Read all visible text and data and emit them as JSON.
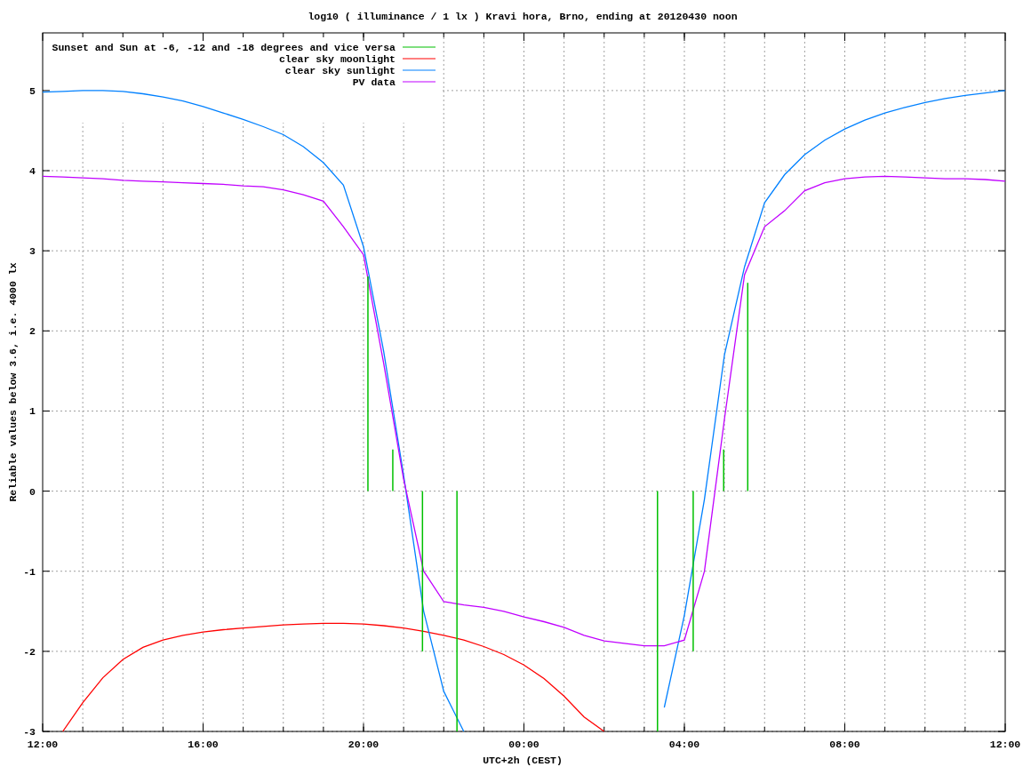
{
  "chart_data": {
    "type": "line",
    "title": "log10 ( illuminance / 1 lx ) Kravi hora, Brno, ending at 20120430 noon",
    "xlabel": "UTC+2h (CEST)",
    "ylabel": "Reliable values below 3.6, i.e. 4000 lx",
    "ylim": [
      -3,
      5.72
    ],
    "grid": true,
    "legend": true,
    "yticks": [
      -3,
      -2,
      -1,
      0,
      1,
      2,
      3,
      4,
      5
    ],
    "categories": [
      "12:00",
      null,
      null,
      null,
      null,
      null,
      null,
      null,
      "16:00",
      null,
      null,
      null,
      null,
      null,
      null,
      null,
      "20:00",
      null,
      null,
      null,
      null,
      null,
      null,
      null,
      "00:00",
      null,
      null,
      null,
      null,
      null,
      null,
      null,
      "04:00",
      null,
      null,
      null,
      null,
      null,
      null,
      null,
      "08:00",
      null,
      null,
      null,
      null,
      null,
      null,
      null,
      "12:00"
    ],
    "series": [
      {
        "name": "clear sky moonlight",
        "color": "#ff0000",
        "values": [
          null,
          -3.0,
          -2.64,
          -2.33,
          -2.1,
          -1.95,
          -1.86,
          -1.8,
          -1.76,
          -1.73,
          -1.71,
          -1.69,
          -1.67,
          -1.66,
          -1.65,
          -1.65,
          -1.66,
          -1.68,
          -1.71,
          -1.75,
          -1.8,
          -1.86,
          -1.94,
          -2.04,
          -2.17,
          -2.34,
          -2.56,
          -2.82,
          -3.0,
          null,
          null,
          null,
          null,
          null,
          null,
          null,
          null,
          null,
          null,
          null,
          null,
          null,
          null,
          null,
          null,
          null,
          null,
          null,
          null
        ]
      },
      {
        "name": "clear sky sunlight",
        "color": "#0080ff",
        "values": [
          4.98,
          4.99,
          5.0,
          5.0,
          4.99,
          4.96,
          4.92,
          4.87,
          4.8,
          4.72,
          4.64,
          4.55,
          4.45,
          4.3,
          4.1,
          3.82,
          3.05,
          1.75,
          0.2,
          -1.5,
          -2.5,
          -3.0,
          null,
          null,
          null,
          null,
          null,
          null,
          null,
          null,
          null,
          -2.7,
          -1.55,
          -0.1,
          1.7,
          2.8,
          3.6,
          3.95,
          4.2,
          4.38,
          4.52,
          4.63,
          4.72,
          4.79,
          4.85,
          4.9,
          4.94,
          4.97,
          5.0
        ]
      },
      {
        "name": "PV data",
        "color": "#c000ff",
        "values": [
          3.93,
          3.92,
          3.91,
          3.9,
          3.88,
          3.87,
          3.86,
          3.85,
          3.84,
          3.83,
          3.81,
          3.8,
          3.76,
          3.7,
          3.62,
          3.3,
          2.95,
          1.6,
          0.15,
          -1.0,
          -1.38,
          -1.42,
          -1.45,
          -1.5,
          -1.57,
          -1.63,
          -1.7,
          -1.8,
          -1.87,
          -1.9,
          -1.93,
          -1.93,
          -1.86,
          -1.0,
          0.9,
          2.7,
          3.3,
          3.5,
          3.75,
          3.85,
          3.9,
          3.92,
          3.93,
          3.92,
          3.91,
          3.9,
          3.9,
          3.89,
          3.87
        ]
      }
    ]
  },
  "event_markers": {
    "label": "Sunset and Sun at -6, -12 and -18 degrees and vice versa",
    "color": "#00c000"
  }
}
